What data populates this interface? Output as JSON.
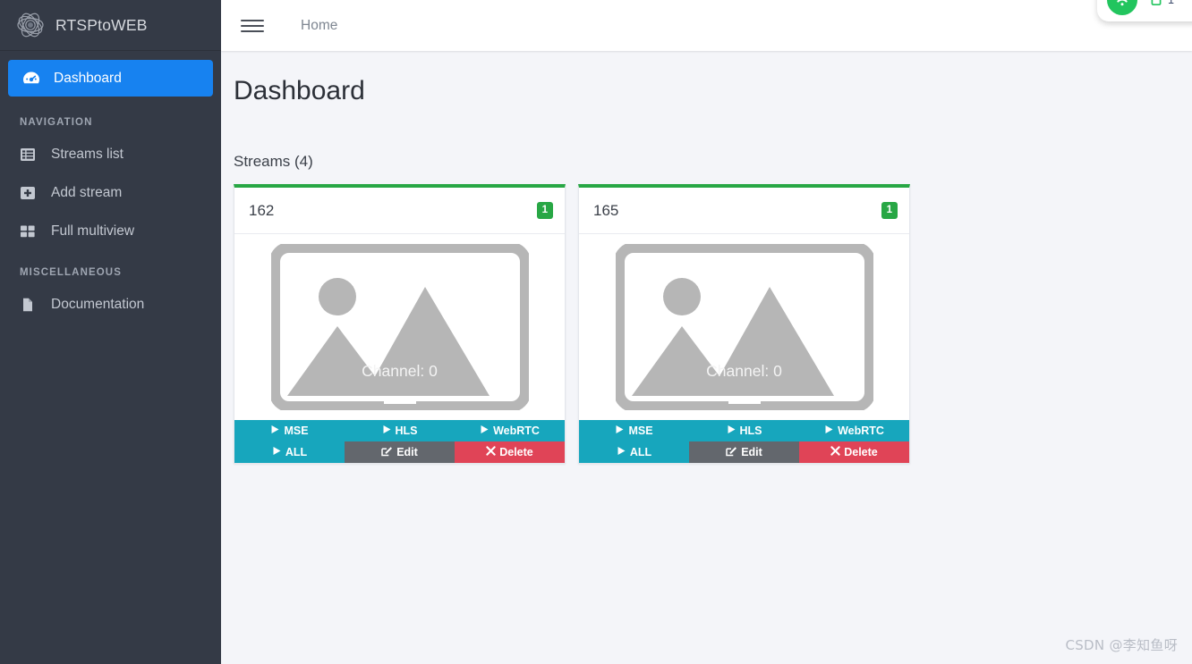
{
  "brand": {
    "name": "RTSPtoWEB",
    "logo_icon": "atom-spiral-icon"
  },
  "sidebar": {
    "active_item": {
      "label": "Dashboard",
      "icon": "tachometer-icon"
    },
    "sections": [
      {
        "heading": "NAVIGATION",
        "items": [
          {
            "label": "Streams list",
            "icon": "list-table-icon"
          },
          {
            "label": "Add stream",
            "icon": "plus-square-icon"
          },
          {
            "label": "Full multiview",
            "icon": "grid-squares-icon"
          }
        ]
      },
      {
        "heading": "MISCELLANEOUS",
        "items": [
          {
            "label": "Documentation",
            "icon": "file-document-icon"
          }
        ]
      }
    ]
  },
  "topbar": {
    "menu_icon": "hamburger-icon",
    "breadcrumb": "Home"
  },
  "status_pill": {
    "wifi_icon": "wifi-icon",
    "device_icon": "mobile-device-icon",
    "device_count": "1"
  },
  "page": {
    "title": "Dashboard",
    "streams_label": "Streams (4)"
  },
  "buttons": {
    "mse": "MSE",
    "hls": "HLS",
    "webrtc": "WebRTC",
    "all": "ALL",
    "edit": "Edit",
    "delete": "Delete",
    "play_icon": "play-icon",
    "edit_icon": "pencil-square-icon",
    "delete_icon": "x-cross-icon"
  },
  "cards": [
    {
      "title": "162",
      "badge": "1",
      "channel_caption": "Channel: 0",
      "placeholder_icon": "broken-image-icon"
    },
    {
      "title": "165",
      "badge": "1",
      "channel_caption": "Channel: 0",
      "placeholder_icon": "broken-image-icon"
    }
  ],
  "watermark": "CSDN @李知鱼呀",
  "colors": {
    "sidebar_bg": "#343a46",
    "active_blue": "#1782f0",
    "card_top_green": "#28a745",
    "button_teal": "#17a6bd",
    "button_gray": "#63676d",
    "button_red": "#e04457",
    "content_bg": "#f4f5f9"
  }
}
